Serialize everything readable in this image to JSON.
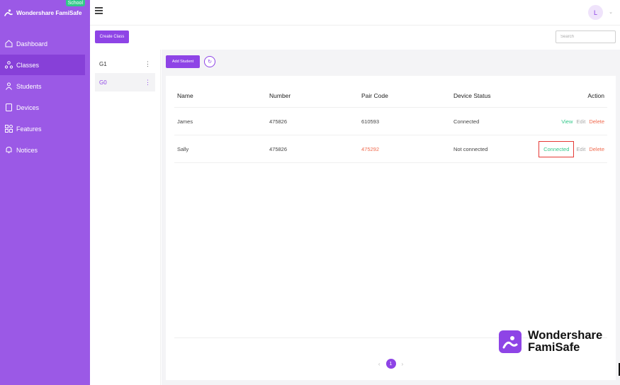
{
  "app": {
    "brand_name": "Wondershare FamiSafe",
    "badge": "School",
    "accent_color": "#8e44e6",
    "sidebar_color": "#9b59e6"
  },
  "sidebar": {
    "items": [
      {
        "label": "Dashboard",
        "icon": "home-icon",
        "active": false
      },
      {
        "label": "Classes",
        "icon": "classes-icon",
        "active": true
      },
      {
        "label": "Students",
        "icon": "students-icon",
        "active": false
      },
      {
        "label": "Devices",
        "icon": "device-icon",
        "active": false
      },
      {
        "label": "Features",
        "icon": "features-grid-icon",
        "active": false
      },
      {
        "label": "Notices",
        "icon": "bell-icon",
        "active": false
      }
    ]
  },
  "topbar": {
    "user_initial": "L"
  },
  "toolbar": {
    "create_class_label": "Create Class",
    "search_placeholder": "Search",
    "add_student_label": "Add Student"
  },
  "classes": [
    {
      "name": "G1",
      "selected": false
    },
    {
      "name": "G0",
      "selected": true
    }
  ],
  "table": {
    "headers": {
      "name": "Name",
      "number": "Number",
      "pair_code": "Pair Code",
      "device_status": "Device Status",
      "action": "Action"
    },
    "rows": [
      {
        "name": "James",
        "number": "475826",
        "pair_code": "610593",
        "device_status": "Connected",
        "actions": [
          "View",
          "Edit",
          "Delete"
        ]
      },
      {
        "name": "Sally",
        "number": "475826",
        "pair_code": "475292",
        "device_status": "Not connected",
        "actions": [
          "Connected",
          "Edit",
          "Delete"
        ]
      }
    ]
  },
  "pagination": {
    "current_page": "1",
    "prev": "‹",
    "next": "›"
  },
  "watermark": {
    "line1": "Wondershare",
    "line2": "FamiSafe"
  }
}
